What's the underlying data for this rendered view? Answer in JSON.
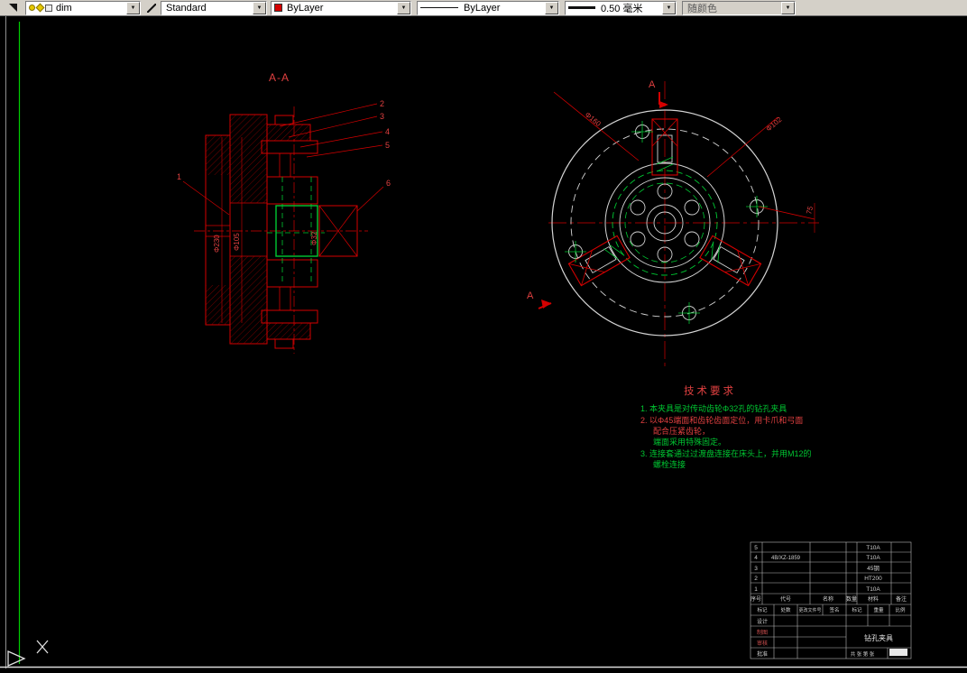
{
  "toolbar": {
    "layer": {
      "value": "dim"
    },
    "text_style": {
      "value": "Standard"
    },
    "color": {
      "value": "ByLayer"
    },
    "linetype": {
      "value": "ByLayer"
    },
    "lineweight": {
      "value": "0.50 毫米"
    },
    "plot_style": {
      "value": "随颜色"
    }
  },
  "drawing": {
    "section_view": {
      "label": "A-A",
      "balloons": [
        "1",
        "2",
        "3",
        "4",
        "5",
        "6"
      ],
      "dims": {
        "d1": "Φ230",
        "d2": "Φ105",
        "d3": "Φ32"
      }
    },
    "circular_view": {
      "section_letter_top": "A",
      "section_letter_bottom": "A",
      "dims": {
        "d1": "Φ160",
        "d2": "Φ102",
        "d3": "75"
      }
    },
    "tech_requirements": {
      "title": "技术要求",
      "lines": [
        {
          "text": "1. 本夹具是对传动齿轮Φ32孔的钻孔夹具",
          "color": "#00c832"
        },
        {
          "text": "2. 以Φ45端面和齿轮齿面定位，用卡爪和弓面",
          "color": "#e04040"
        },
        {
          "text": "配合压紧齿轮，",
          "color": "#e04040"
        },
        {
          "text": "端面采用特殊固定。",
          "color": "#00c832"
        },
        {
          "text": "3. 连接套通过过渡盘连接在床头上，并用M12的",
          "color": "#00c832"
        },
        {
          "text": "螺栓连接",
          "color": "#00c832"
        }
      ]
    },
    "title_block": {
      "headers": {
        "no": "序号",
        "code": "代号",
        "name": "名称",
        "qty": "数量",
        "mat": "材料",
        "note": "备注"
      },
      "parts": [
        {
          "no": "5",
          "code": "",
          "name": "",
          "qty": "",
          "mat": "T10A"
        },
        {
          "no": "4",
          "code": "4B/XZ-1859",
          "name": "",
          "qty": "",
          "mat": "T10A"
        },
        {
          "no": "3",
          "code": "",
          "name": "",
          "qty": "",
          "mat": "45钢"
        },
        {
          "no": "2",
          "code": "",
          "name": "",
          "qty": "",
          "mat": "HT200"
        },
        {
          "no": "1",
          "code": "",
          "name": "",
          "qty": "",
          "mat": "T10A"
        }
      ],
      "revision_headers": [
        "标记",
        "处数",
        "更改文件号",
        "签名"
      ],
      "sign_labels": [
        "设计",
        "制图",
        "审核",
        "批准"
      ],
      "info_labels": {
        "stage": "标记",
        "weight": "重量",
        "scale": "比例"
      },
      "drawing_title": "钻孔夹具",
      "sheet_info": "共 张 第 张"
    }
  },
  "colors": {
    "cad_red": "#d40000",
    "cad_green": "#00c832",
    "cad_white": "#d4d4d4",
    "frame_green": "#00cf00",
    "toolbar_gray": "#d4d0c8"
  }
}
